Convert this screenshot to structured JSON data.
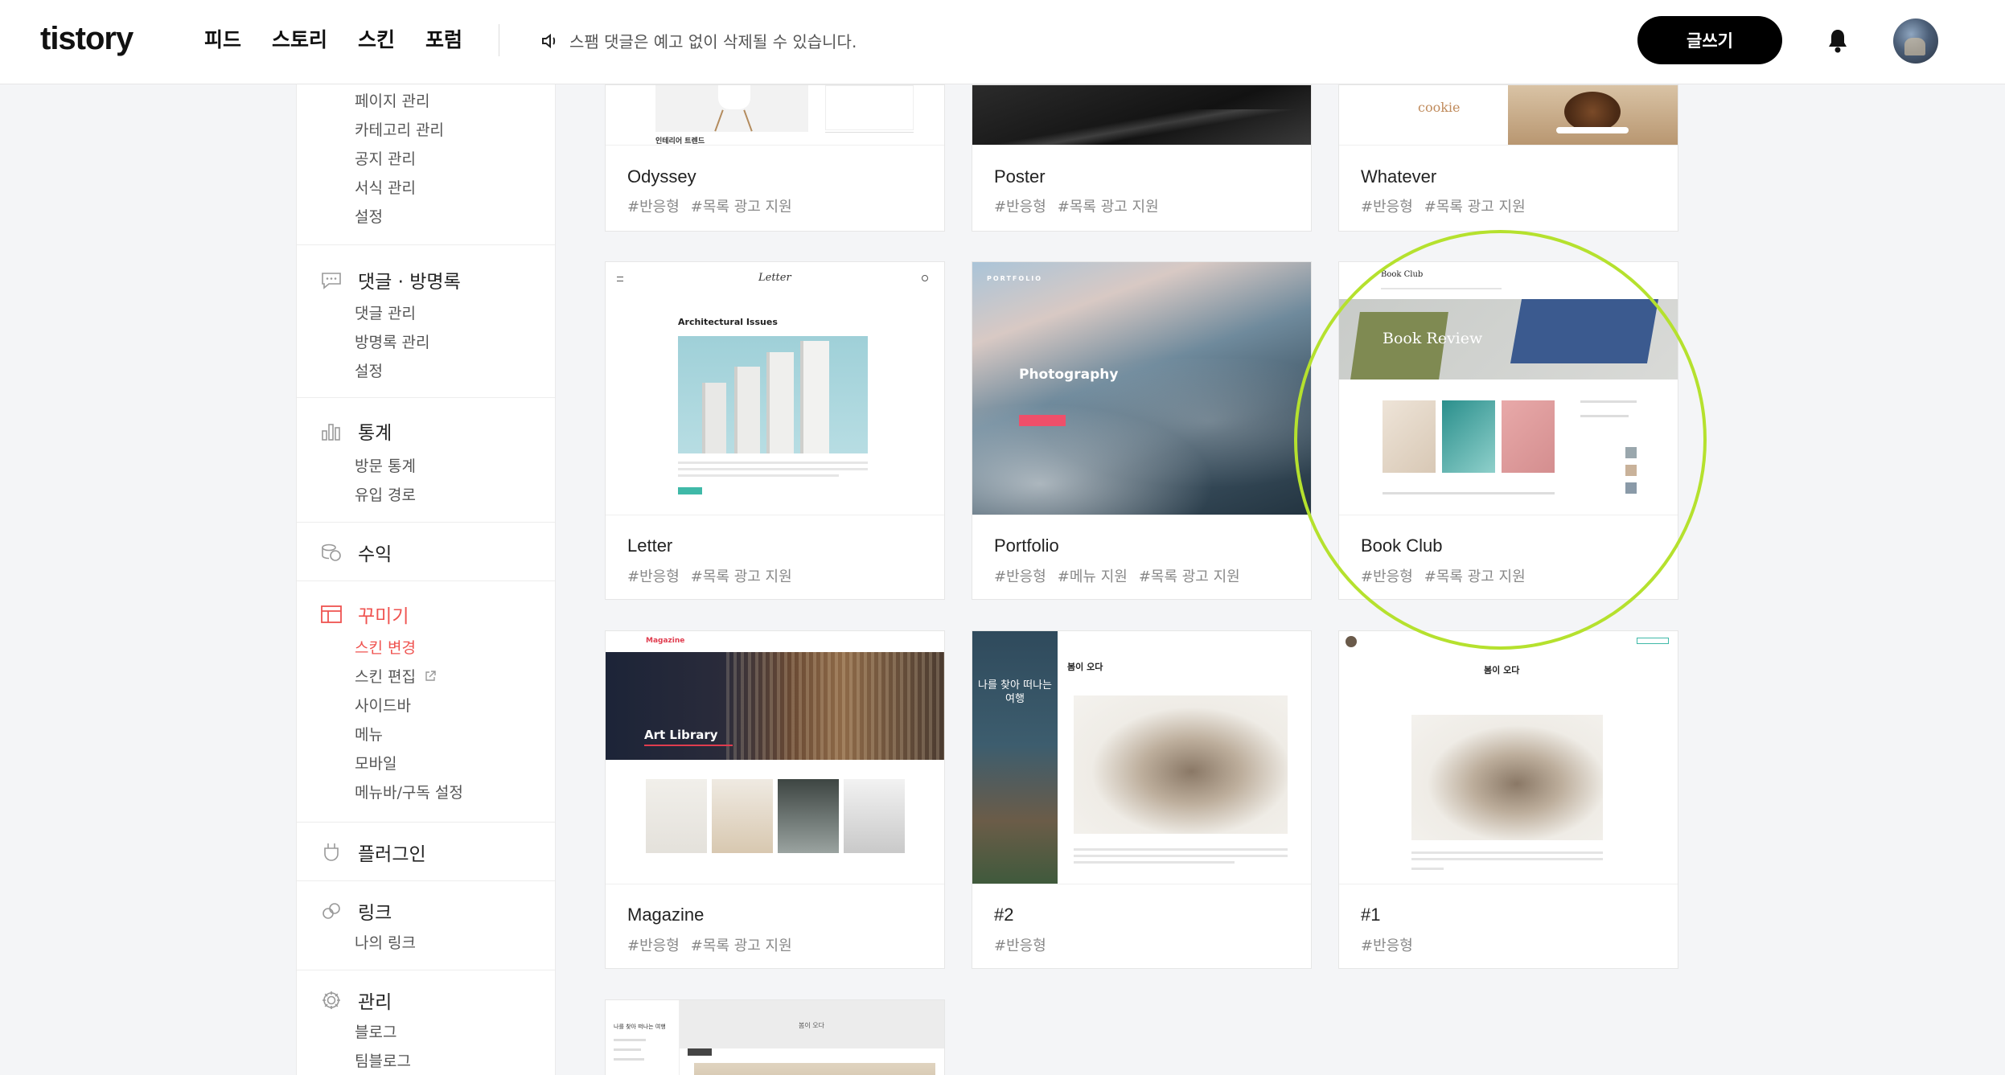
{
  "header": {
    "logo": "tistory",
    "nav": [
      "피드",
      "스토리",
      "스킨",
      "포럼"
    ],
    "notice": "스팸 댓글은 예고 없이 삭제될 수 있습니다.",
    "write_label": "글쓰기"
  },
  "sidebar": {
    "top_items": [
      "페이지 관리",
      "카테고리 관리",
      "공지 관리",
      "서식 관리",
      "설정"
    ],
    "comments": {
      "title": "댓글 · 방명록",
      "items": [
        "댓글 관리",
        "방명록 관리",
        "설정"
      ]
    },
    "stats": {
      "title": "통계",
      "items": [
        "방문 통계",
        "유입 경로"
      ]
    },
    "revenue": {
      "title": "수익"
    },
    "decorate": {
      "title": "꾸미기",
      "items": [
        "스킨 변경",
        "스킨 편집",
        "사이드바",
        "메뉴",
        "모바일",
        "메뉴바/구독 설정"
      ]
    },
    "plugin": {
      "title": "플러그인"
    },
    "link": {
      "title": "링크",
      "items": [
        "나의 링크"
      ]
    },
    "manage": {
      "title": "관리",
      "items": [
        "블로그",
        "팀블로그"
      ]
    }
  },
  "skins": [
    {
      "name": "Odyssey",
      "tags": [
        "#반응형",
        "#목록 광고 지원"
      ],
      "thumb_text": "인테리어 트렌드"
    },
    {
      "name": "Poster",
      "tags": [
        "#반응형",
        "#목록 광고 지원"
      ]
    },
    {
      "name": "Whatever",
      "tags": [
        "#반응형",
        "#목록 광고 지원"
      ],
      "thumb_text": "cookie"
    },
    {
      "name": "Letter",
      "tags": [
        "#반응형",
        "#목록 광고 지원"
      ],
      "thumb_title": "Letter",
      "thumb_text": "Architectural Issues"
    },
    {
      "name": "Portfolio",
      "tags": [
        "#반응형",
        "#메뉴 지원",
        "#목록 광고 지원"
      ],
      "thumb_label": "PORTFOLIO",
      "thumb_text": "Photography"
    },
    {
      "name": "Book Club",
      "tags": [
        "#반응형",
        "#목록 광고 지원"
      ],
      "thumb_title": "Book Club",
      "thumb_text": "Book Review"
    },
    {
      "name": "Magazine",
      "tags": [
        "#반응형",
        "#목록 광고 지원"
      ],
      "thumb_title": "Magazine",
      "thumb_text": "Art Library"
    },
    {
      "name": "#2",
      "tags": [
        "#반응형"
      ],
      "thumb_side": "나를 찾아 떠나는 여행",
      "thumb_text": "봄이 오다"
    },
    {
      "name": "#1",
      "tags": [
        "#반응형"
      ],
      "thumb_text": "봄이 오다"
    },
    {
      "thumb_side": "나를 찾아 떠나는 여행",
      "thumb_text": "봄이 오다"
    }
  ],
  "colors": {
    "accent": "#ef5350",
    "highlight": "#b5e12e",
    "button": "#000000"
  }
}
